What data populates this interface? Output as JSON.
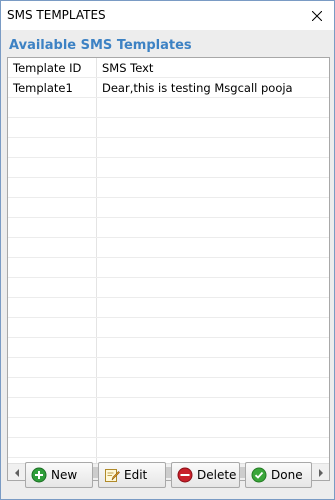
{
  "window": {
    "title": "SMS TEMPLATES",
    "close_icon": "close-icon"
  },
  "section": {
    "title": "Available SMS Templates"
  },
  "table": {
    "columns": [
      "Template ID",
      "SMS Text"
    ],
    "rows": [
      [
        "Template1",
        "Dear,this is testing Msgcall pooja"
      ]
    ]
  },
  "buttons": {
    "new_label": "New",
    "edit_label": "Edit",
    "delete_label": "Delete",
    "done_label": "Done",
    "new_icon": "plus-circle-icon",
    "edit_icon": "pencil-icon",
    "delete_icon": "minus-circle-icon",
    "done_icon": "check-circle-icon"
  },
  "colors": {
    "section_title": "#3d82c4",
    "new_icon": "#2e9e3a",
    "delete_icon": "#c8202a",
    "done_icon": "#3aa63a"
  }
}
